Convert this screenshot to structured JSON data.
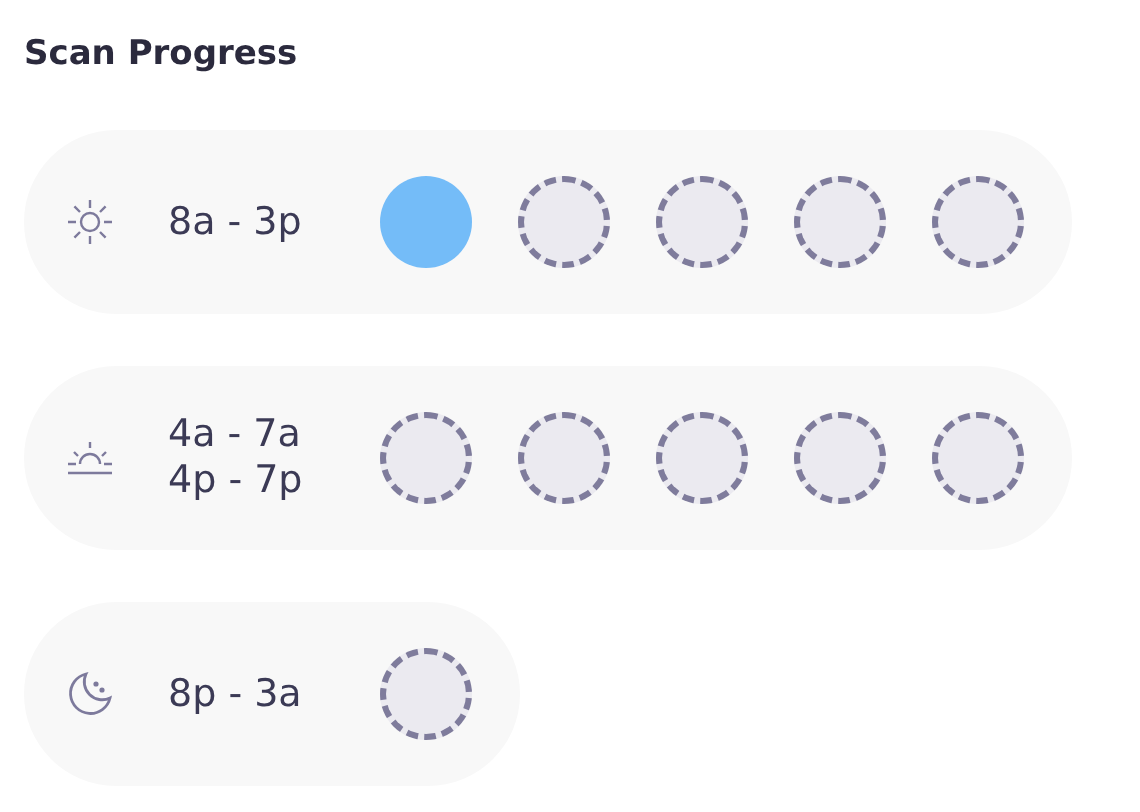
{
  "title": "Scan Progress",
  "rows": [
    {
      "kind": "sun",
      "times": [
        "8a - 3p"
      ],
      "slots": [
        {
          "done": true
        },
        {
          "done": false
        },
        {
          "done": false
        },
        {
          "done": false
        },
        {
          "done": false
        }
      ]
    },
    {
      "kind": "sunrise",
      "times": [
        "4a - 7a",
        "4p - 7p"
      ],
      "slots": [
        {
          "done": false
        },
        {
          "done": false
        },
        {
          "done": false
        },
        {
          "done": false
        },
        {
          "done": false
        }
      ]
    },
    {
      "kind": "moon",
      "times": [
        "8p - 3a"
      ],
      "slots": [
        {
          "done": false
        }
      ]
    }
  ]
}
